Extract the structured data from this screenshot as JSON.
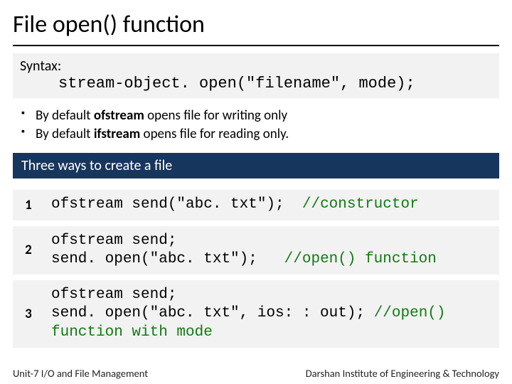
{
  "title": "File open() function",
  "syntax": {
    "label": "Syntax:",
    "code": "stream-object. open(\"filename\", mode);"
  },
  "bullets": [
    {
      "pre": "By default ",
      "bold": "ofstream",
      "post": " opens file for writing only"
    },
    {
      "pre": "By default  ",
      "bold": "ifstream",
      "post": " opens file for reading only."
    }
  ],
  "subheading": "Three ways to create a file",
  "rows": [
    {
      "num": "1",
      "code_main": "ofstream send(\"abc. txt\");  ",
      "code_comment": "//constructor"
    },
    {
      "num": "2",
      "code_main": "ofstream send;\nsend. open(\"abc. txt\");   ",
      "code_comment": "//open() function"
    },
    {
      "num": "3",
      "code_main": "ofstream send;\nsend. open(\"abc. txt\", ios: : out); ",
      "code_comment": "//open() function with mode"
    }
  ],
  "footer": {
    "left": "Unit-7 I/O and File Management",
    "right": "Darshan Institute of Engineering & Technology"
  }
}
